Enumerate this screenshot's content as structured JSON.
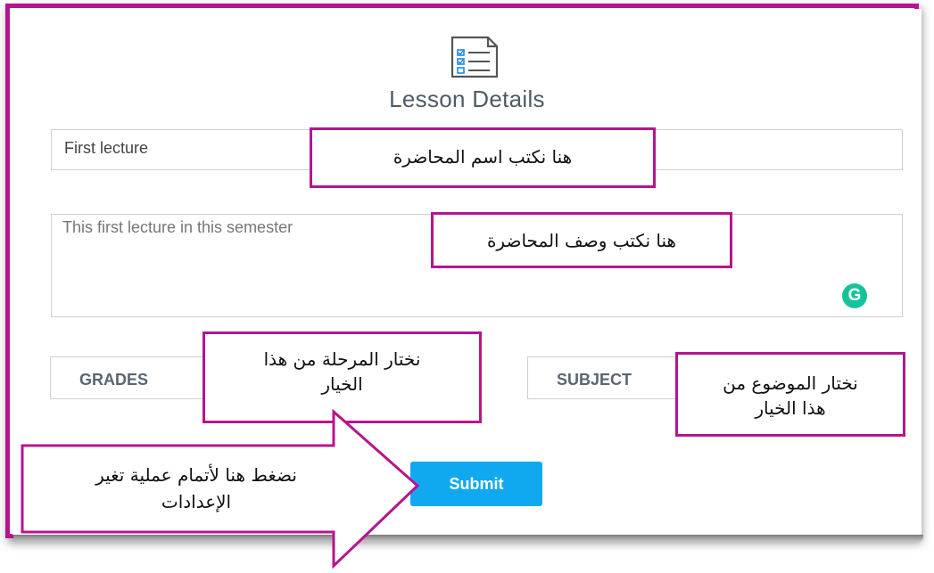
{
  "form": {
    "title": "Lesson Details",
    "name_value": "First lecture",
    "description_placeholder": "This first lecture in this semester",
    "grades_label": "GRADES",
    "subject_label": "SUBJECT",
    "submit_label": "Submit",
    "grammarly_letter": "G"
  },
  "callouts": {
    "name": "هنا نكتب اسم المحاضرة",
    "description": "هنا نكتب  وصف المحاضرة",
    "grades_line1": "نختار المرحلة من هذا",
    "grades_line2": "الخيار",
    "subject_line1": "نختار الموضوع من",
    "subject_line2": "هذا الخيار",
    "submit_line1": "نضغط هنا لأتمام عملية تغير",
    "submit_line2": "الإعدادات"
  },
  "colors": {
    "annotation": "#b4158f",
    "submit": "#10a9ef",
    "grammarly": "#15c39a",
    "title": "#4f5b66"
  },
  "icons": {
    "header": "document-checklist-icon",
    "grammarly": "grammarly-icon",
    "pointer": "arrow-right-icon"
  }
}
